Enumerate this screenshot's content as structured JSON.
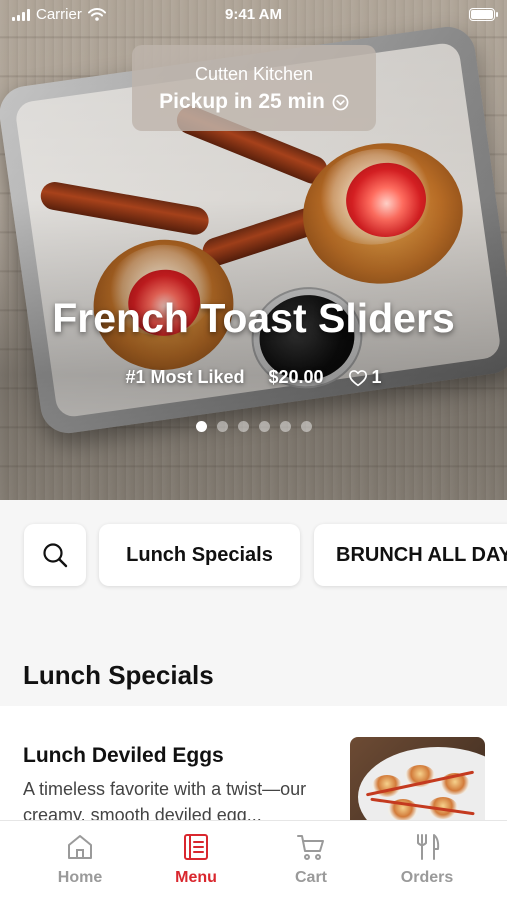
{
  "status_bar": {
    "carrier": "Carrier",
    "time": "9:41 AM"
  },
  "pickup": {
    "restaurant": "Cutten Kitchen",
    "pickup_text": "Pickup in 25 min"
  },
  "hero": {
    "title": "French Toast Sliders",
    "badge": "#1 Most Liked",
    "price": "$20.00",
    "likes": "1",
    "page_count": 6,
    "active_page": 1
  },
  "categories": {
    "search_icon": "search-icon",
    "items": [
      "Lunch Specials",
      "BRUNCH ALL DAY"
    ]
  },
  "section": {
    "title": "Lunch Specials"
  },
  "menu_item": {
    "name": "Lunch Deviled Eggs",
    "description": "A timeless favorite with a twist—our creamy, smooth deviled egg..."
  },
  "tabs": [
    {
      "label": "Home",
      "icon": "home-icon"
    },
    {
      "label": "Menu",
      "icon": "menu-book-icon"
    },
    {
      "label": "Cart",
      "icon": "cart-icon"
    },
    {
      "label": "Orders",
      "icon": "fork-knife-icon"
    }
  ],
  "colors": {
    "accent": "#d9272e",
    "inactive_tab": "#9a9a9a"
  }
}
